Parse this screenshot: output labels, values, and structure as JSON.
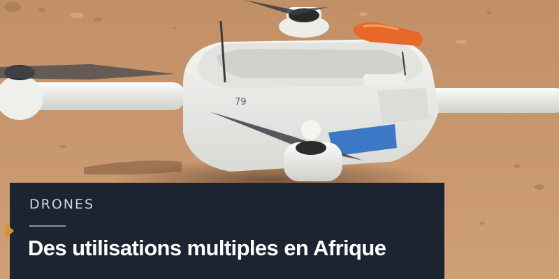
{
  "article": {
    "kicker": "DRONES",
    "headline": "Des utilisations multiples en Afrique"
  },
  "photo": {
    "drone_number": "79"
  },
  "colors": {
    "sand": "#c6936a",
    "caption_bg": "#1c2331",
    "accent_arrow": "#d99033",
    "drone_body": "#eeeeea",
    "drone_blue_panel": "#3d78c6"
  }
}
